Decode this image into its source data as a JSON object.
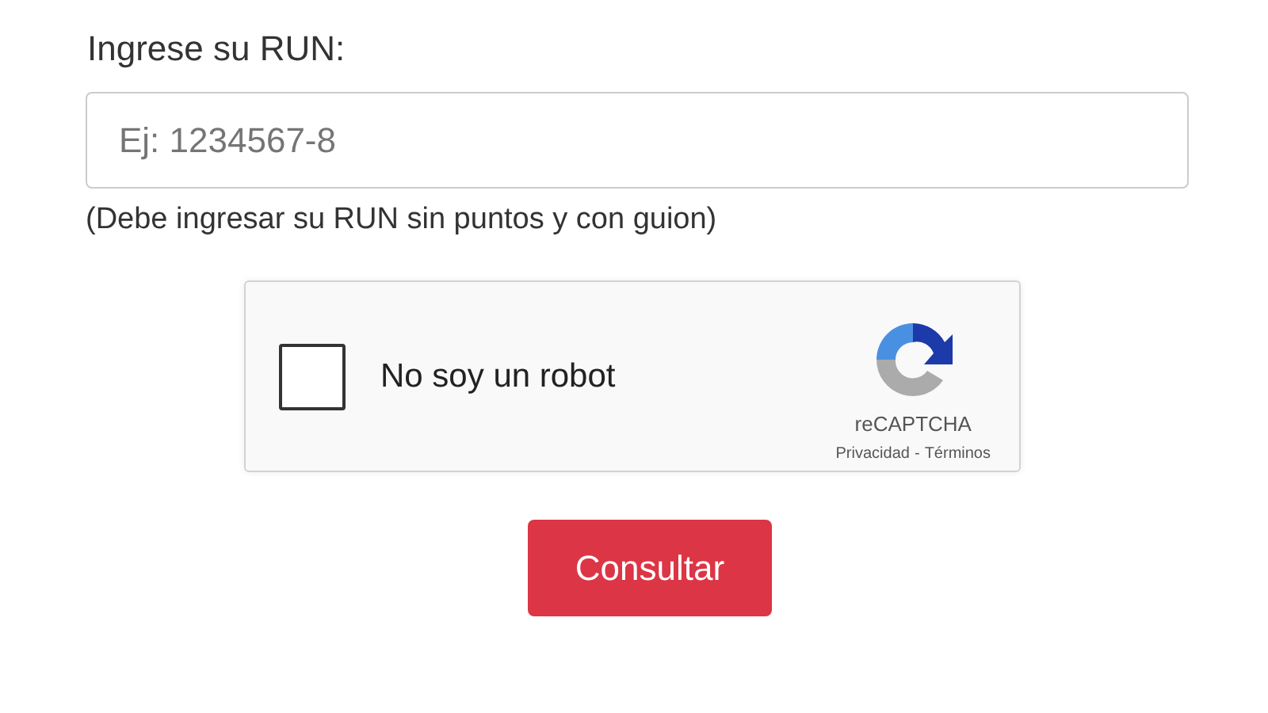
{
  "run_field": {
    "label": "Ingrese su RUN:",
    "placeholder": "Ej: 1234567-8",
    "help": "(Debe ingresar su RUN sin puntos y con guion)"
  },
  "captcha": {
    "label": "No soy un robot",
    "checked": false,
    "brand": "reCAPTCHA",
    "links": [
      "Privacidad",
      "-",
      "Términos"
    ]
  },
  "submit": {
    "label": "Consultar"
  }
}
